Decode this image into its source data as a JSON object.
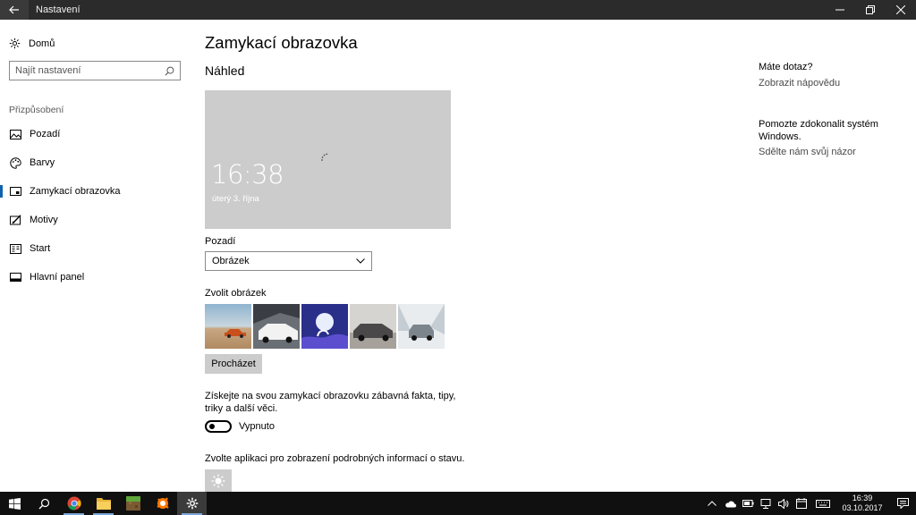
{
  "window": {
    "title": "Nastavení"
  },
  "sidebar": {
    "home_label": "Domů",
    "search_placeholder": "Najít nastavení",
    "section_label": "Přizpůsobení",
    "items": [
      {
        "label": "Pozadí",
        "icon": "picture-icon"
      },
      {
        "label": "Barvy",
        "icon": "palette-icon"
      },
      {
        "label": "Zamykací obrazovka",
        "icon": "lock-screen-icon",
        "active": true
      },
      {
        "label": "Motivy",
        "icon": "brush-icon"
      },
      {
        "label": "Start",
        "icon": "start-icon"
      },
      {
        "label": "Hlavní panel",
        "icon": "taskbar-icon"
      }
    ]
  },
  "main": {
    "title": "Zamykací obrazovka",
    "preview_heading": "Náhled",
    "preview_time": "16:38",
    "preview_date": "úterý 3. října",
    "background_label": "Pozadí",
    "background_value": "Obrázek",
    "choose_picture_label": "Zvolit obrázek",
    "browse_label": "Procházet",
    "tips_text": "Získejte na svou zamykací obrazovku zábavná fakta, tipy, triky a další věci.",
    "tips_toggle_label": "Vypnuto",
    "tips_toggle_on": false,
    "status_text": "Zvolte aplikaci pro zobrazení podrobných informací o stavu."
  },
  "right": {
    "question_heading": "Máte dotaz?",
    "help_link": "Zobrazit nápovědu",
    "improve_heading": "Pomozte zdokonalit systém Windows.",
    "feedback_link": "Sdělte nám svůj názor"
  },
  "taskbar": {
    "time": "16:39",
    "date": "03.10.2017",
    "apps": [
      "windows-start-icon",
      "search-icon",
      "chrome-icon",
      "file-explorer-icon",
      "minecraft-icon",
      "avast-icon",
      "settings-icon"
    ]
  },
  "colors": {
    "titlebar": "#2b2b2b",
    "accent": "#0f62ad",
    "preview_bg": "#cccccc",
    "taskbar": "#101010"
  }
}
